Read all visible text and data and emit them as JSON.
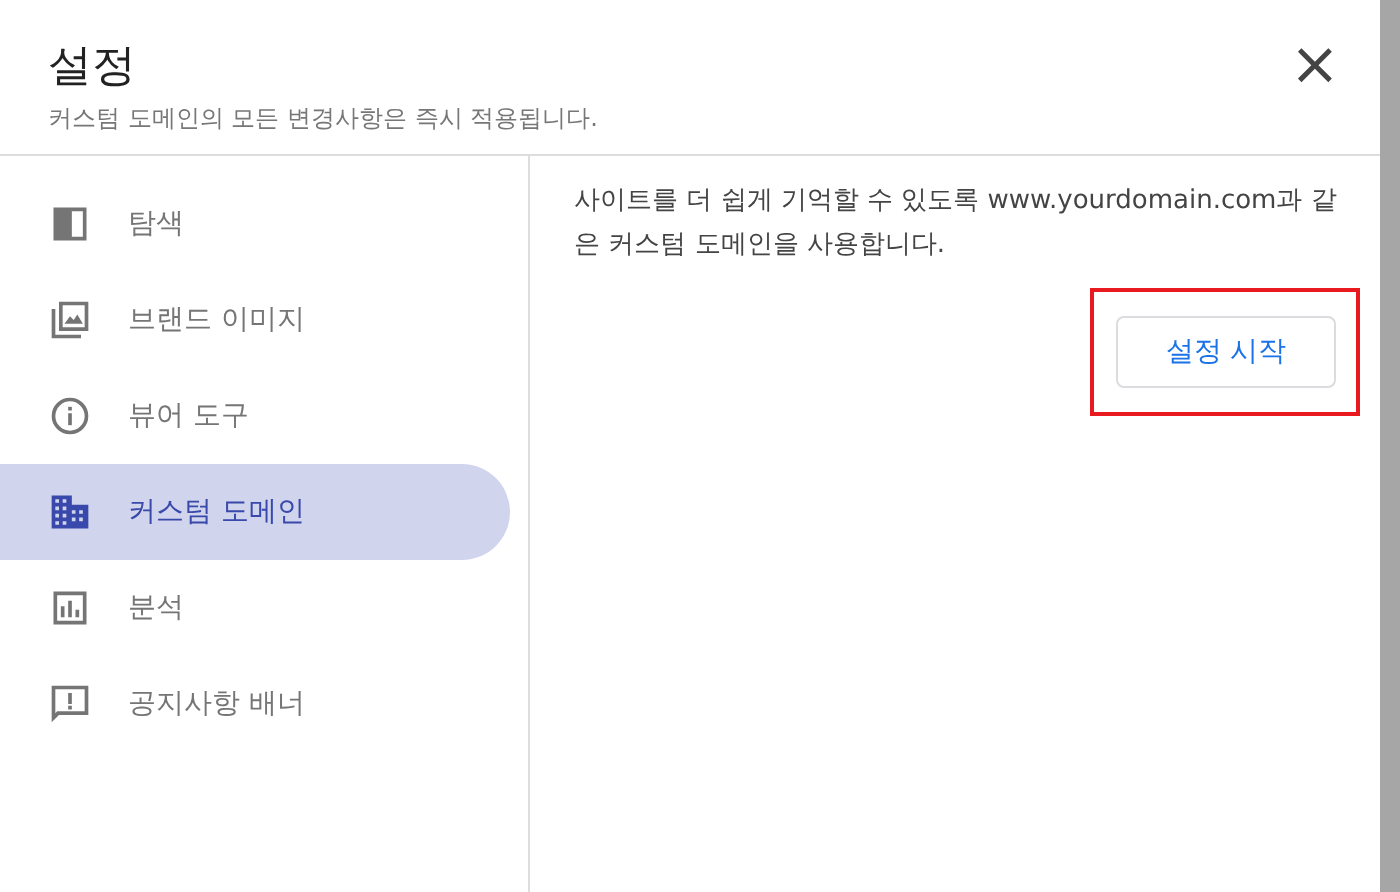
{
  "dialog": {
    "title": "설정",
    "subtitle": "커스텀 도메인의 모든 변경사항은 즉시 적용됩니다.",
    "close": "×"
  },
  "sidebar": {
    "items": [
      {
        "kind": "panel",
        "label": "탐색",
        "selected": false
      },
      {
        "kind": "image",
        "label": "브랜드 이미지",
        "selected": false
      },
      {
        "kind": "info",
        "label": "뷰어 도구",
        "selected": false
      },
      {
        "kind": "building",
        "label": "커스텀 도메인",
        "selected": true
      },
      {
        "kind": "chart",
        "label": "분석",
        "selected": false
      },
      {
        "kind": "alert",
        "label": "공지사항 배너",
        "selected": false
      }
    ]
  },
  "content": {
    "description": "사이트를 더 쉽게 기억할 수 있도록 www.yourdomain.com과 같은 커스텀 도메인을 사용합니다.",
    "button": {
      "label": "설정 시작",
      "highlighted": true
    }
  }
}
